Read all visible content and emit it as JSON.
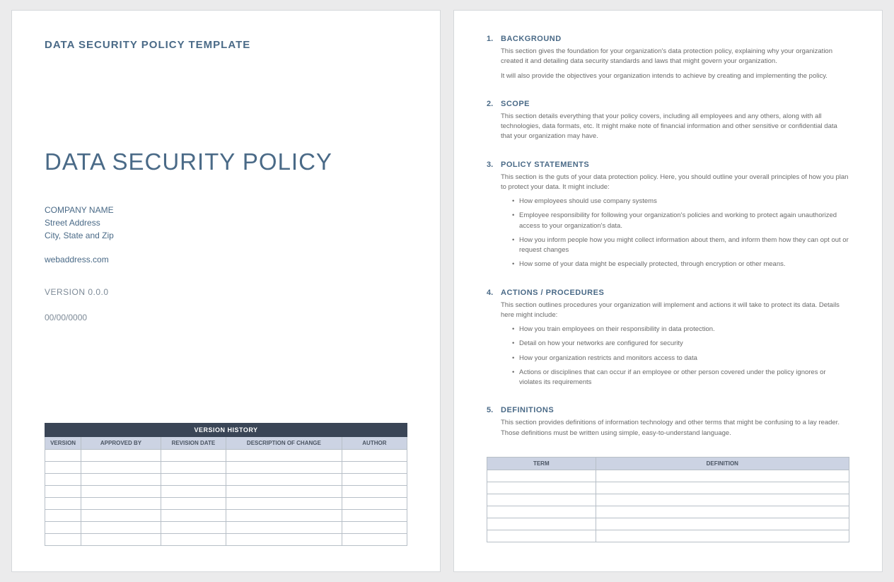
{
  "page1": {
    "template_header": "DATA SECURITY POLICY TEMPLATE",
    "title": "DATA SECURITY POLICY",
    "company_name": "COMPANY NAME",
    "street": "Street Address",
    "city": "City, State and Zip",
    "web": "webaddress.com",
    "version": "VERSION 0.0.0",
    "date": "00/00/0000",
    "version_history": {
      "title": "VERSION HISTORY",
      "columns": [
        "VERSION",
        "APPROVED BY",
        "REVISION DATE",
        "DESCRIPTION OF CHANGE",
        "AUTHOR"
      ],
      "rows": 8
    }
  },
  "page2": {
    "sections": [
      {
        "num": "1.",
        "title": "BACKGROUND",
        "paras": [
          "This section gives the foundation for your organization's data protection policy, explaining why your organization created it and detailing data security standards and laws that might govern your organization.",
          "It will also provide the objectives your organization intends to achieve by creating and implementing the policy."
        ],
        "bullets": []
      },
      {
        "num": "2.",
        "title": "SCOPE",
        "paras": [
          "This section details everything that your policy covers, including all employees and any others, along with all technologies, data formats, etc.  It might make note of financial information and other sensitive or confidential data that your organization may have."
        ],
        "bullets": []
      },
      {
        "num": "3.",
        "title": "POLICY STATEMENTS",
        "paras": [
          "This section is the guts of your data protection policy. Here, you should outline your overall principles of how you plan to protect your data.  It might include:"
        ],
        "bullets": [
          "How employees should use company systems",
          "Employee responsibility for following your organization's policies and working to protect again unauthorized access to your organization's data.",
          "How you inform people how you might collect information about them, and inform them how they can opt out or request changes",
          "How some of your data might be especially protected, through encryption or other means."
        ]
      },
      {
        "num": "4.",
        "title": "ACTIONS / PROCEDURES",
        "paras": [
          "This section outlines procedures your organization will implement and actions it will take to protect its data. Details here might include:"
        ],
        "bullets": [
          "How you train employees on their responsibility in data protection.",
          "Detail on how your networks are configured for security",
          "How your organization restricts and monitors access to data",
          "Actions or disciplines that can occur if an employee or other person covered under the policy ignores or violates its requirements"
        ]
      },
      {
        "num": "5.",
        "title": "DEFINITIONS",
        "paras": [
          "This section provides definitions of information technology and other terms that might be confusing to a lay reader. Those definitions must be written using simple, easy-to-understand language."
        ],
        "bullets": []
      }
    ],
    "definitions_table": {
      "columns": [
        "TERM",
        "DEFINITION"
      ],
      "rows": 6
    }
  }
}
